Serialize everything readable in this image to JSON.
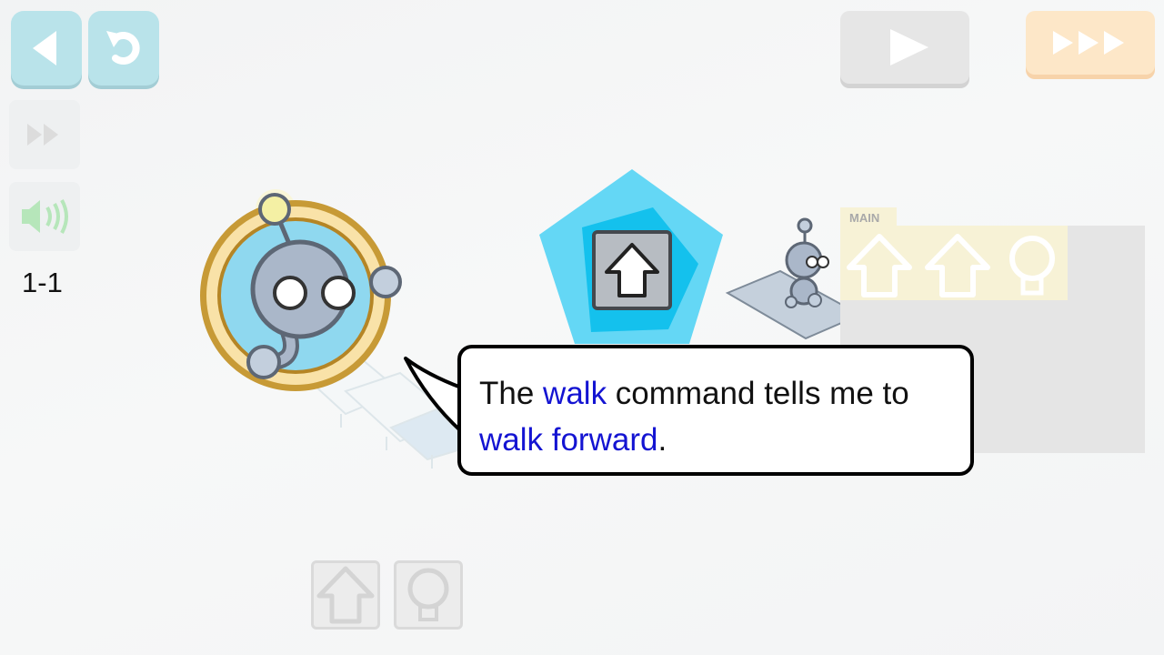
{
  "toolbar": {
    "back_icon": "back-arrow-icon",
    "restart_icon": "restart-icon",
    "skip_icon": "fast-forward-icon",
    "sound_icon": "speaker-icon",
    "play_icon": "play-icon",
    "speed_icon": "triple-forward-icon"
  },
  "level": "1-1",
  "program": {
    "main_label": "MAIN",
    "main_slots": [
      "walk",
      "walk",
      "light"
    ]
  },
  "tutorial": {
    "text_1": "The ",
    "highlight_1": "walk",
    "text_2": " command tells me to",
    "highlight_2": "walk forward",
    "text_3": "."
  },
  "highlighted_command": "walk",
  "command_tray": [
    "walk",
    "light"
  ],
  "colors": {
    "accent_blue": "#1414d2",
    "button_cyan": "#b9e3ea",
    "speed_orange": "#fde7c8",
    "pentagon": "#64d7f5"
  }
}
